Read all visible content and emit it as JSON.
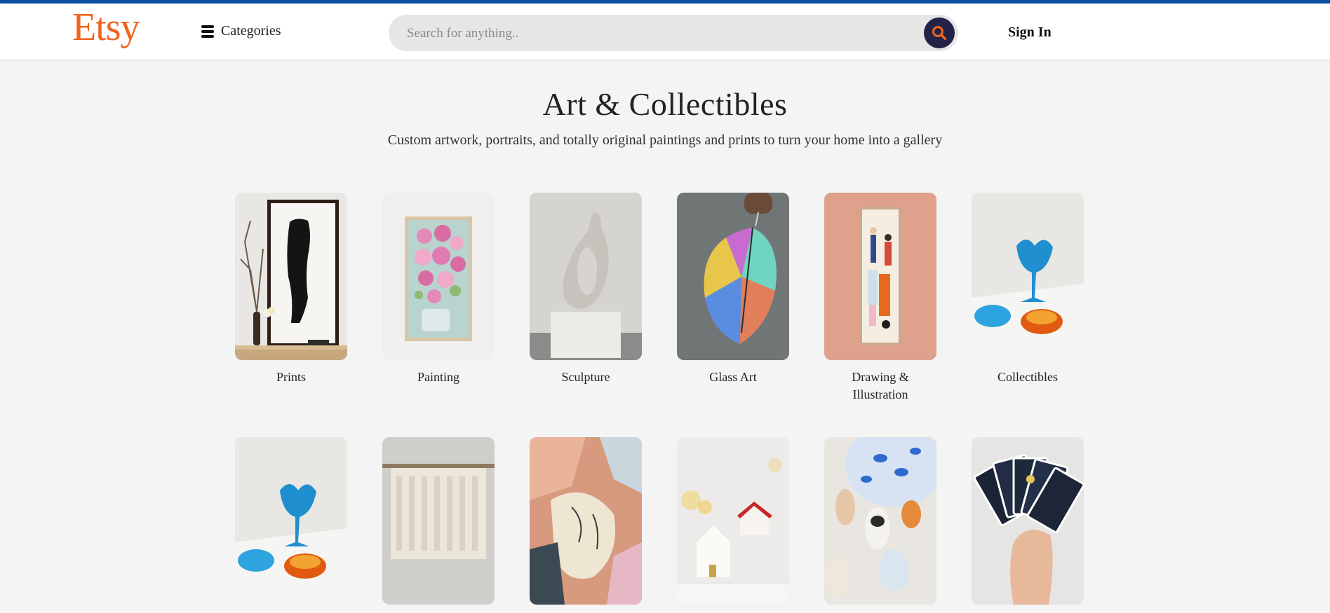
{
  "header": {
    "logo": "Etsy",
    "categories_label": "Categories",
    "search_placeholder": "Search for anything..",
    "signin_label": "Sign In"
  },
  "hero": {
    "title": "Art & Collectibles",
    "subtitle": "Custom artwork, portraits, and totally original paintings and prints to turn your home into a gallery"
  },
  "categories": [
    {
      "label": "Prints"
    },
    {
      "label": "Painting"
    },
    {
      "label": "Sculpture"
    },
    {
      "label": "Glass Art"
    },
    {
      "label": "Drawing & Illustration"
    },
    {
      "label": "Collectibles"
    },
    {
      "label": ""
    },
    {
      "label": ""
    },
    {
      "label": ""
    },
    {
      "label": ""
    },
    {
      "label": ""
    },
    {
      "label": ""
    }
  ],
  "colors": {
    "brand": "#f1641e",
    "accent_bar": "#0b4da2",
    "search_button": "#232347"
  }
}
